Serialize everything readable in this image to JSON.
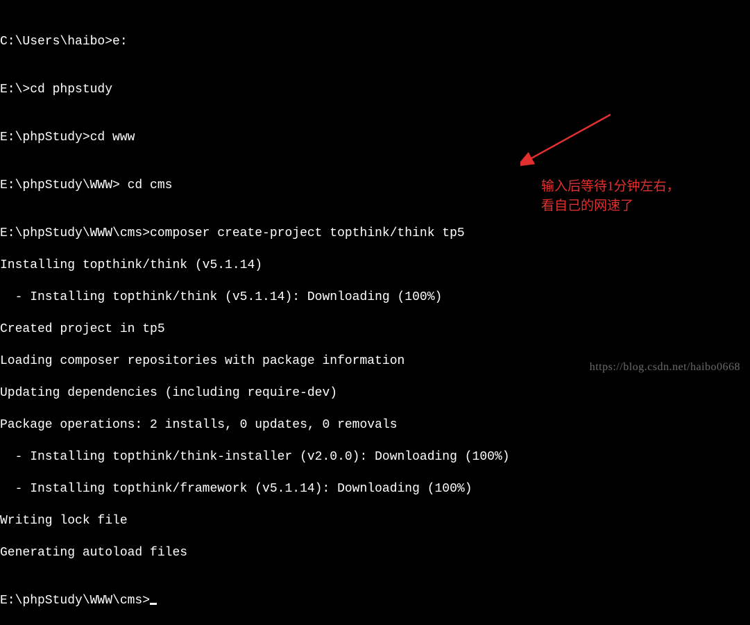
{
  "terminal": {
    "lines": [
      "C:\\Users\\haibo>e:",
      "",
      "E:\\>cd phpstudy",
      "",
      "E:\\phpStudy>cd www",
      "",
      "E:\\phpStudy\\WWW> cd cms",
      "",
      "E:\\phpStudy\\WWW\\cms>composer create-project topthink/think tp5",
      "Installing topthink/think (v5.1.14)",
      "  - Installing topthink/think (v5.1.14): Downloading (100%)",
      "Created project in tp5",
      "Loading composer repositories with package information",
      "Updating dependencies (including require-dev)",
      "Package operations: 2 installs, 0 updates, 0 removals",
      "  - Installing topthink/think-installer (v2.0.0): Downloading (100%)",
      "  - Installing topthink/framework (v5.1.14): Downloading (100%)",
      "Writing lock file",
      "Generating autoload files",
      "",
      "E:\\phpStudy\\WWW\\cms>"
    ]
  },
  "annotation": {
    "line1": "输入后等待1分钟左右，",
    "line2": "看自己的网速了"
  },
  "watermark": "https://blog.csdn.net/haibo0668",
  "colors": {
    "annotation": "#e03030"
  }
}
